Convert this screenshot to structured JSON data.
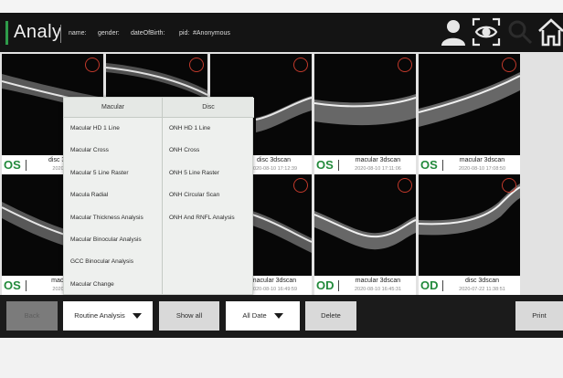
{
  "header": {
    "title": "Analy",
    "name_label": "name:",
    "gender_label": "gender:",
    "dob_label": "dateOfBirth:",
    "pid_label": "pid:",
    "pid_value": "#Anonymous",
    "icons": [
      "user-icon",
      "eye-scan-icon",
      "search-icon",
      "home-icon"
    ]
  },
  "gallery": {
    "tiles": [
      {
        "eye": "OS",
        "type": "disc 3dscan",
        "date": "2020-08-10"
      },
      {
        "eye": "",
        "type": "",
        "date": ""
      },
      {
        "eye": "",
        "type": "disc 3dscan",
        "date": "2020-08-10 17:12:39"
      },
      {
        "eye": "OS",
        "type": "macular 3dscan",
        "date": "2020-08-10 17:11:06"
      },
      {
        "eye": "OS",
        "type": "macular 3dscan",
        "date": "2020-08-10 17:08:50"
      },
      {
        "eye": "OS",
        "type": "macular 3",
        "date": "2020-08-10"
      },
      {
        "eye": "",
        "type": "",
        "date": ""
      },
      {
        "eye": "",
        "type": "macular 3dscan",
        "date": "2020-08-10 16:49:59"
      },
      {
        "eye": "OD",
        "type": "macular 3dscan",
        "date": "2020-08-10 16:45:31"
      },
      {
        "eye": "OD",
        "type": "disc 3dscan",
        "date": "2020-07-22 11:38:51"
      }
    ]
  },
  "menu": {
    "macular_header": "Macular",
    "disc_header": "Disc",
    "macular_items": [
      "Macular HD 1 Line",
      "Macular Cross",
      "Macular 5 Line Raster",
      "Macula Radial",
      "Macular Thickness Analysis",
      "Macular Binocular Analysis",
      "GCC Binocular Analysis",
      "Macular Change"
    ],
    "disc_items": [
      "ONH HD 1 Line",
      "ONH Cross",
      "ONH 5 Line Raster",
      "ONH Circular Scan",
      "ONH And RNFL Analysis"
    ]
  },
  "toolbar": {
    "back_label": "Back",
    "analysis_label": "Routine Analysis",
    "show_all_label": "Show all",
    "date_label": "All Date",
    "delete_label": "Delete",
    "print_label": "Print"
  },
  "colors": {
    "accent_green": "#2e9b4a",
    "eye_label_green": "#238a3c",
    "marker_red": "#c0392b"
  }
}
